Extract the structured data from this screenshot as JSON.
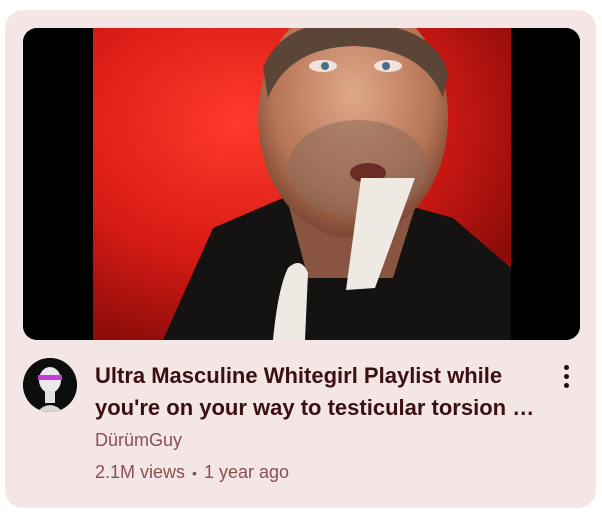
{
  "video": {
    "title": "Ultra Masculine Whitegirl Playlist while you're on your way to testicular torsion …",
    "channel": "DürümGuy",
    "views": "2.1M views",
    "separator": "•",
    "age": "1 year ago"
  },
  "icons": {
    "menu": "more-vertical-icon"
  },
  "colors": {
    "card_background": "#f5e6e6",
    "title": "#3b1010",
    "meta": "#8a4f52",
    "thumbnail_backdrop": "#e0201a"
  }
}
